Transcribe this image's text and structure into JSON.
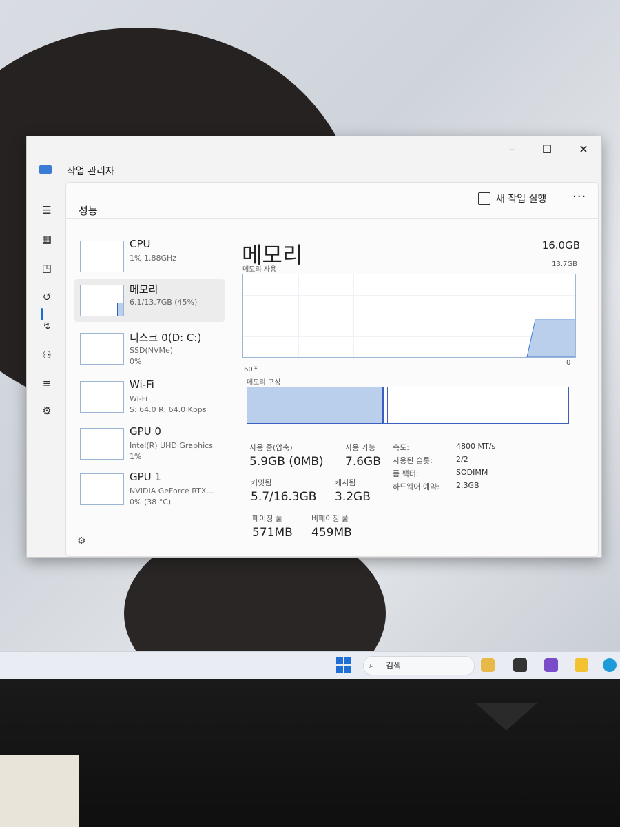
{
  "window": {
    "title": "작업 관리자",
    "controls": {
      "minimize": "–",
      "maximize": "☐",
      "close": "✕"
    }
  },
  "toolbar": {
    "section_title": "성능",
    "run_new_task": "새 작업 실행",
    "more": "···"
  },
  "sidebar_icons": [
    "menu-icon",
    "processes-icon",
    "performance-icon",
    "app-history-icon",
    "startup-icon",
    "users-icon",
    "details-icon",
    "services-icon",
    "settings-icon"
  ],
  "resources": [
    {
      "name": "CPU",
      "sub1": "1% 1.88GHz",
      "sub2": ""
    },
    {
      "name": "메모리",
      "sub1": "6.1/13.7GB (45%)",
      "sub2": ""
    },
    {
      "name": "디스크 0(D: C:)",
      "sub1": "SSD(NVMe)",
      "sub2": "0%"
    },
    {
      "name": "Wi-Fi",
      "sub1": "Wi-Fi",
      "sub2": "S: 64.0 R: 64.0 Kbps"
    },
    {
      "name": "GPU 0",
      "sub1": "Intel(R) UHD Graphics",
      "sub2": "1%"
    },
    {
      "name": "GPU 1",
      "sub1": "NVIDIA GeForce RTX...",
      "sub2": "0% (38 °C)"
    }
  ],
  "memory": {
    "title": "메모리",
    "total": "16.0GB",
    "usage_label": "메모리 사용",
    "usage_max": "13.7GB",
    "axis_left": "60초",
    "axis_right": "0",
    "composition_label": "메모리 구성",
    "composition_used_fraction": 0.45,
    "stats": {
      "in_use_label": "사용 중(압축)",
      "in_use_value": "5.9GB (0MB)",
      "available_label": "사용 가능",
      "available_value": "7.6GB",
      "committed_label": "커밋됨",
      "committed_value": "5.7/16.3GB",
      "cached_label": "캐시됨",
      "cached_value": "3.2GB",
      "paged_label": "페이징 풀",
      "paged_value": "571MB",
      "nonpaged_label": "비페이징 풀",
      "nonpaged_value": "459MB"
    },
    "details": [
      {
        "key": "속도:",
        "value": "4800 MT/s"
      },
      {
        "key": "사용된 슬롯:",
        "value": "2/2"
      },
      {
        "key": "폼 팩터:",
        "value": "SODIMM"
      },
      {
        "key": "하드웨어 예약:",
        "value": "2.3GB"
      }
    ]
  },
  "taskbar": {
    "search_placeholder": "검색"
  }
}
